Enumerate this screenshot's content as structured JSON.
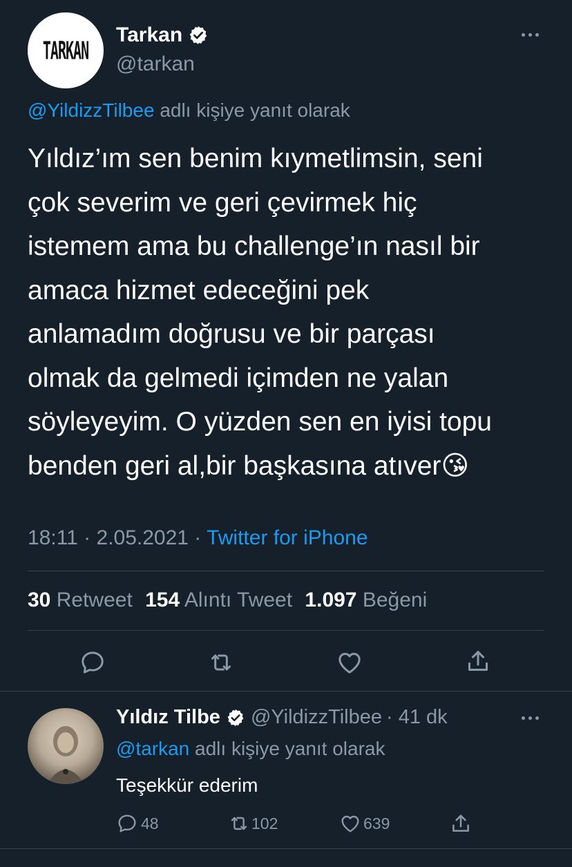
{
  "main_tweet": {
    "author_name": "Tarkan",
    "author_handle": "@tarkan",
    "logo_text": "TARKAN",
    "reply_to_handle": "@YildizzTilbee",
    "reply_to_suffix": "adlı kişiye yanıt olarak",
    "text_lines": [
      "Yıldız’ım sen benim kıymetlimsin, seni",
      "çok severim ve geri çevirmek hiç",
      "istemem ama bu challenge’ın nasıl bir",
      "amaca hizmet edeceğini pek",
      "anlamadım doğrusu ve bir parçası",
      "olmak da gelmedi içimden ne yalan",
      "söyleyeyim. O yüzden sen en iyisi topu",
      "benden geri al,bir başkasına atıver"
    ],
    "emoji": "😘",
    "timestamp": "18:11 · 2.05.2021 ·",
    "source": "Twitter for iPhone",
    "stats": {
      "retweets_count": "30",
      "retweets_label": "Retweet",
      "quotes_count": "154",
      "quotes_label": "Alıntı Tweet",
      "likes_count": "1.097",
      "likes_label": "Beğeni"
    },
    "actions": [
      "reply-icon",
      "retweet-icon",
      "like-icon",
      "share-icon"
    ]
  },
  "reply_tweet": {
    "author_name": "Yıldız Tilbe",
    "author_handle": "@YildizzTilbee",
    "time": "· 41 dk",
    "reply_to_handle": "@tarkan",
    "reply_to_suffix": "adlı kişiye yanıt olarak",
    "text": "Teşekkür ederim",
    "reply_count": "48",
    "retweet_count": "102",
    "like_count": "639"
  },
  "colors": {
    "background": "#15202b",
    "accent": "#1d9bf0",
    "muted": "#8b98a5",
    "divider": "#38444d"
  }
}
